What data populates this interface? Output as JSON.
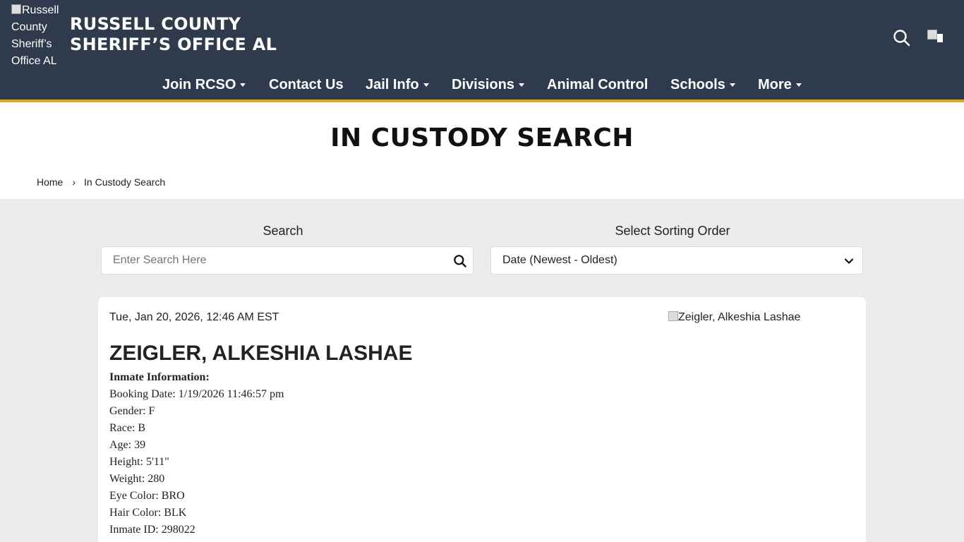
{
  "header": {
    "logo_alt": "Russell County Sheriff’s Office AL",
    "title_line1": "RUSSELL COUNTY",
    "title_line2": "SHERIFF’S OFFICE AL",
    "icons": [
      "search-icon",
      "flag-icon"
    ]
  },
  "nav": {
    "items": [
      {
        "label": "Join RCSO",
        "dropdown": true
      },
      {
        "label": "Contact Us",
        "dropdown": false
      },
      {
        "label": "Jail Info",
        "dropdown": true
      },
      {
        "label": "Divisions",
        "dropdown": true
      },
      {
        "label": "Animal Control",
        "dropdown": false
      },
      {
        "label": "Schools",
        "dropdown": true
      },
      {
        "label": "More",
        "dropdown": true
      }
    ]
  },
  "page": {
    "title": "IN CUSTODY SEARCH",
    "breadcrumb": {
      "home": "Home",
      "separator": "›",
      "current": "In Custody Search"
    }
  },
  "controls": {
    "search_label": "Search",
    "search_placeholder": "Enter Search Here",
    "search_value": "",
    "sort_label": "Select Sorting Order",
    "sort_value": "Date (Newest - Oldest)"
  },
  "inmate": {
    "date": "Tue, Jan 20, 2026, 12:46 AM EST",
    "photo_alt": "Zeigler, Alkeshia Lashae",
    "name": "ZEIGLER, ALKESHIA LASHAE",
    "info_header": "Inmate Information:",
    "fields": [
      "Booking Date: 1/19/2026 11:46:57 pm",
      "Gender: F",
      "Race: B",
      "Age: 39",
      "Height: 5'11\"",
      "Weight: 280",
      "Eye Color: BRO",
      "Hair Color: BLK",
      "Inmate ID: 298022"
    ]
  },
  "colors": {
    "header_bg": "#2f3b4c",
    "accent_stripe": "#d9a81c",
    "page_bg": "#ececec"
  }
}
